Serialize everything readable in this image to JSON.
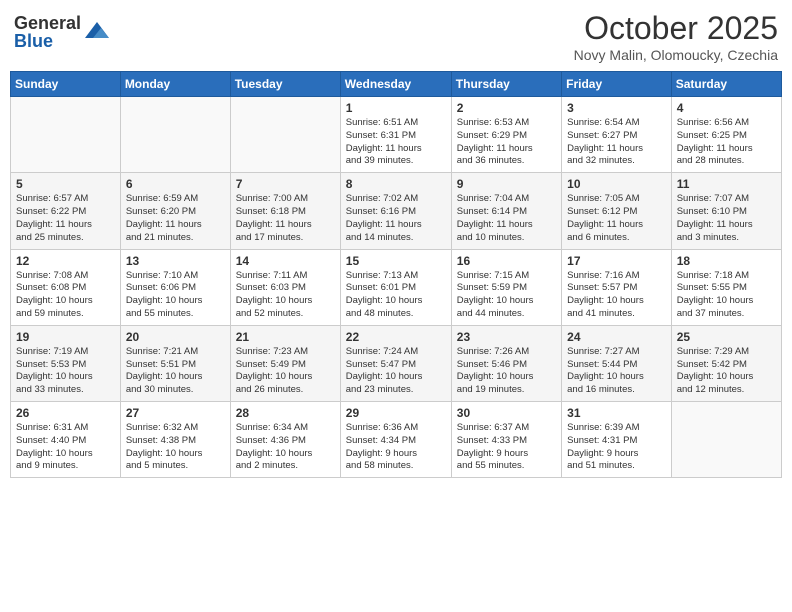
{
  "header": {
    "logo_general": "General",
    "logo_blue": "Blue",
    "month": "October 2025",
    "location": "Novy Malin, Olomoucky, Czechia"
  },
  "weekdays": [
    "Sunday",
    "Monday",
    "Tuesday",
    "Wednesday",
    "Thursday",
    "Friday",
    "Saturday"
  ],
  "weeks": [
    [
      {
        "day": "",
        "info": ""
      },
      {
        "day": "",
        "info": ""
      },
      {
        "day": "",
        "info": ""
      },
      {
        "day": "1",
        "info": "Sunrise: 6:51 AM\nSunset: 6:31 PM\nDaylight: 11 hours\nand 39 minutes."
      },
      {
        "day": "2",
        "info": "Sunrise: 6:53 AM\nSunset: 6:29 PM\nDaylight: 11 hours\nand 36 minutes."
      },
      {
        "day": "3",
        "info": "Sunrise: 6:54 AM\nSunset: 6:27 PM\nDaylight: 11 hours\nand 32 minutes."
      },
      {
        "day": "4",
        "info": "Sunrise: 6:56 AM\nSunset: 6:25 PM\nDaylight: 11 hours\nand 28 minutes."
      }
    ],
    [
      {
        "day": "5",
        "info": "Sunrise: 6:57 AM\nSunset: 6:22 PM\nDaylight: 11 hours\nand 25 minutes."
      },
      {
        "day": "6",
        "info": "Sunrise: 6:59 AM\nSunset: 6:20 PM\nDaylight: 11 hours\nand 21 minutes."
      },
      {
        "day": "7",
        "info": "Sunrise: 7:00 AM\nSunset: 6:18 PM\nDaylight: 11 hours\nand 17 minutes."
      },
      {
        "day": "8",
        "info": "Sunrise: 7:02 AM\nSunset: 6:16 PM\nDaylight: 11 hours\nand 14 minutes."
      },
      {
        "day": "9",
        "info": "Sunrise: 7:04 AM\nSunset: 6:14 PM\nDaylight: 11 hours\nand 10 minutes."
      },
      {
        "day": "10",
        "info": "Sunrise: 7:05 AM\nSunset: 6:12 PM\nDaylight: 11 hours\nand 6 minutes."
      },
      {
        "day": "11",
        "info": "Sunrise: 7:07 AM\nSunset: 6:10 PM\nDaylight: 11 hours\nand 3 minutes."
      }
    ],
    [
      {
        "day": "12",
        "info": "Sunrise: 7:08 AM\nSunset: 6:08 PM\nDaylight: 10 hours\nand 59 minutes."
      },
      {
        "day": "13",
        "info": "Sunrise: 7:10 AM\nSunset: 6:06 PM\nDaylight: 10 hours\nand 55 minutes."
      },
      {
        "day": "14",
        "info": "Sunrise: 7:11 AM\nSunset: 6:03 PM\nDaylight: 10 hours\nand 52 minutes."
      },
      {
        "day": "15",
        "info": "Sunrise: 7:13 AM\nSunset: 6:01 PM\nDaylight: 10 hours\nand 48 minutes."
      },
      {
        "day": "16",
        "info": "Sunrise: 7:15 AM\nSunset: 5:59 PM\nDaylight: 10 hours\nand 44 minutes."
      },
      {
        "day": "17",
        "info": "Sunrise: 7:16 AM\nSunset: 5:57 PM\nDaylight: 10 hours\nand 41 minutes."
      },
      {
        "day": "18",
        "info": "Sunrise: 7:18 AM\nSunset: 5:55 PM\nDaylight: 10 hours\nand 37 minutes."
      }
    ],
    [
      {
        "day": "19",
        "info": "Sunrise: 7:19 AM\nSunset: 5:53 PM\nDaylight: 10 hours\nand 33 minutes."
      },
      {
        "day": "20",
        "info": "Sunrise: 7:21 AM\nSunset: 5:51 PM\nDaylight: 10 hours\nand 30 minutes."
      },
      {
        "day": "21",
        "info": "Sunrise: 7:23 AM\nSunset: 5:49 PM\nDaylight: 10 hours\nand 26 minutes."
      },
      {
        "day": "22",
        "info": "Sunrise: 7:24 AM\nSunset: 5:47 PM\nDaylight: 10 hours\nand 23 minutes."
      },
      {
        "day": "23",
        "info": "Sunrise: 7:26 AM\nSunset: 5:46 PM\nDaylight: 10 hours\nand 19 minutes."
      },
      {
        "day": "24",
        "info": "Sunrise: 7:27 AM\nSunset: 5:44 PM\nDaylight: 10 hours\nand 16 minutes."
      },
      {
        "day": "25",
        "info": "Sunrise: 7:29 AM\nSunset: 5:42 PM\nDaylight: 10 hours\nand 12 minutes."
      }
    ],
    [
      {
        "day": "26",
        "info": "Sunrise: 6:31 AM\nSunset: 4:40 PM\nDaylight: 10 hours\nand 9 minutes."
      },
      {
        "day": "27",
        "info": "Sunrise: 6:32 AM\nSunset: 4:38 PM\nDaylight: 10 hours\nand 5 minutes."
      },
      {
        "day": "28",
        "info": "Sunrise: 6:34 AM\nSunset: 4:36 PM\nDaylight: 10 hours\nand 2 minutes."
      },
      {
        "day": "29",
        "info": "Sunrise: 6:36 AM\nSunset: 4:34 PM\nDaylight: 9 hours\nand 58 minutes."
      },
      {
        "day": "30",
        "info": "Sunrise: 6:37 AM\nSunset: 4:33 PM\nDaylight: 9 hours\nand 55 minutes."
      },
      {
        "day": "31",
        "info": "Sunrise: 6:39 AM\nSunset: 4:31 PM\nDaylight: 9 hours\nand 51 minutes."
      },
      {
        "day": "",
        "info": ""
      }
    ]
  ]
}
